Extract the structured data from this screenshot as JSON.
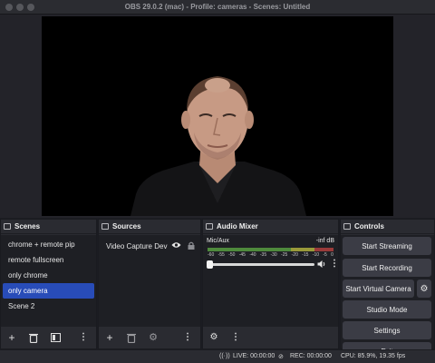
{
  "window": {
    "title": "OBS 29.0.2 (mac) - Profile: cameras - Scenes: Untitled"
  },
  "scenes": {
    "header": "Scenes",
    "items": [
      {
        "label": "chrome + remote pip"
      },
      {
        "label": "remote fullscreen"
      },
      {
        "label": "only chrome"
      },
      {
        "label": "only camera",
        "selected": true
      },
      {
        "label": "Scene 2"
      }
    ]
  },
  "sources": {
    "header": "Sources",
    "items": [
      {
        "label": "Video Capture Devi"
      }
    ]
  },
  "audio_mixer": {
    "header": "Audio Mixer",
    "channel_name": "Mic/Aux",
    "level": "-inf dB",
    "scale": [
      "-60",
      "-55",
      "-50",
      "-45",
      "-40",
      "-35",
      "-30",
      "-25",
      "-20",
      "-15",
      "-10",
      "-5",
      "0"
    ]
  },
  "controls": {
    "header": "Controls",
    "start_streaming": "Start Streaming",
    "start_recording": "Start Recording",
    "start_virtual_camera": "Start Virtual Camera",
    "studio_mode": "Studio Mode",
    "settings": "Settings",
    "exit": "Exit"
  },
  "status": {
    "live": "LIVE: 00:00:00",
    "rec": "REC: 00:00:00",
    "cpu": "CPU: 85.9%, 19.35 fps"
  },
  "colors": {
    "selected": "#284cb8",
    "button": "#3b3c45",
    "meter_green": "#4e8a3c",
    "meter_yellow": "#9a9a3a",
    "meter_red": "#9a3a3a"
  }
}
